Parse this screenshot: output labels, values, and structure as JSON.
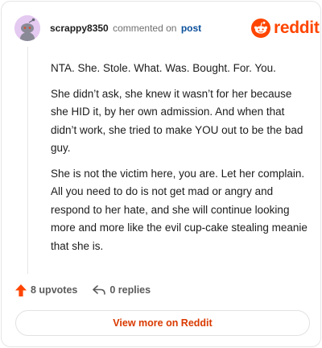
{
  "comment": {
    "username": "scrappy8350",
    "action_text": "commented on",
    "post_link_label": "post",
    "paragraphs": [
      "NTA. She. Stole. What. Was. Bought. For. You.",
      "She didn’t ask, she knew it wasn’t for her because she HID it, by her own admission. And when that didn’t work, she tried to make YOU out to be the bad guy.",
      "She is not the victim here, you are. Let her complain. All you need to do is not get mad or angry and respond to her hate, and she will continue looking more and more like the evil cup-cake stealing meanie that she is."
    ],
    "upvotes_label": "8 upvotes",
    "replies_label": "0 replies"
  },
  "brand": {
    "wordmark": "reddit",
    "logo_icon": "reddit-alien-icon",
    "accent_color": "#ff4500"
  },
  "footer": {
    "view_more_label": "View more on Reddit",
    "link_color": "#d93a00"
  },
  "icons": {
    "avatar": "snoo-avatar",
    "upvote": "upvote-arrow-icon",
    "reply": "reply-arrow-icon"
  }
}
